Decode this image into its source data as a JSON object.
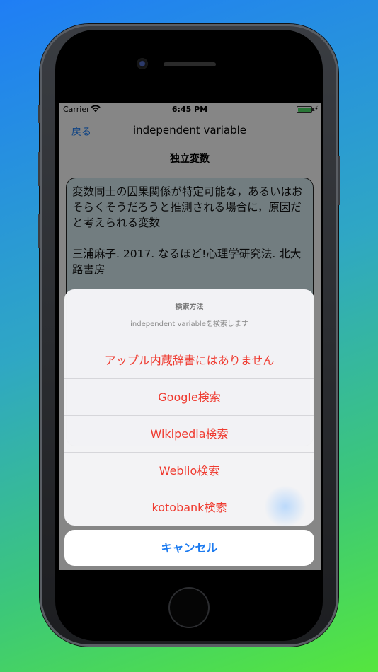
{
  "status_bar": {
    "carrier": "Carrier",
    "time": "6:45 PM",
    "charge_symbol": "⚡"
  },
  "nav": {
    "back_label": "戻る",
    "title": "independent variable"
  },
  "term": {
    "japanese": "独立変数"
  },
  "definition": {
    "text": "変数同士の因果関係が特定可能な，あるいはおそらくそうだろうと推測される場合に，原因だと考えられる変数",
    "citation": "三浦麻子. 2017. なるほど!心理学研究法. 北大路書房"
  },
  "action_sheet": {
    "title": "検索方法",
    "message": "independent variableを検索します",
    "items": [
      {
        "label": "アップル内蔵辞書にはありません"
      },
      {
        "label": "Google検索"
      },
      {
        "label": "Wikipedia検索"
      },
      {
        "label": "Weblio検索"
      },
      {
        "label": "kotobank検索"
      }
    ],
    "cancel_label": "キャンセル"
  },
  "colors": {
    "accent_blue": "#1e7cf0",
    "destructive_red": "#ef3b30",
    "battery_green": "#4cd964"
  }
}
